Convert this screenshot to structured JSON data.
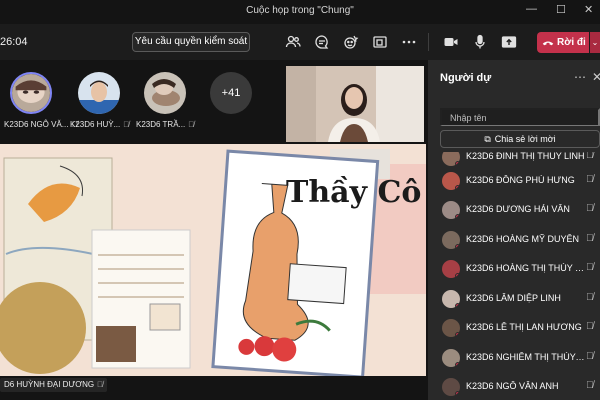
{
  "window": {
    "title": "Cuộc họp trong \"Chung\""
  },
  "toolbar": {
    "time": "26:04",
    "request_control_label": "Yêu cầu quyền kiểm soát",
    "leave_label": "Rời đi",
    "icons": [
      "people-icon",
      "chat-icon",
      "reactions-icon",
      "rooms-icon",
      "more-icon",
      "camera-icon",
      "mic-icon",
      "share-tray-icon",
      "phone-icon"
    ]
  },
  "stage": {
    "participants": [
      {
        "name": "K23D6 NGÔ VĂ...",
        "muted": true,
        "active": true
      },
      {
        "name": "K23D6 HUỲ...",
        "muted": true
      },
      {
        "name": "K23D6 TRẦ...",
        "muted": true
      }
    ],
    "overflow_count": "+41",
    "presenter": "D6 HUỲNH ĐẠI DƯƠNG"
  },
  "shared_content": {
    "card_heading": "Thầy Cô"
  },
  "panel": {
    "title": "Người dự",
    "search_placeholder": "Nhập tên",
    "share_invite_label": "Chia sẻ lời mời",
    "attendees": [
      "K23D6 ĐINH THỊ THÚY LINH",
      "K23D6 ĐỒNG PHÚ HƯNG",
      "K23D6 DƯƠNG HẢI VÂN",
      "K23D6 HOÀNG MỸ DUYÊN",
      "K23D6 HOÀNG THỊ THÚY HƯ...",
      "K23D6 LÂM DIỆP LINH",
      "K23D6 LÊ THỊ LAN HƯƠNG",
      "K23D6 NGHIÊM THỊ THÙY LI...",
      "K23D6 NGÔ VÂN ANH"
    ]
  },
  "colors": {
    "leave": "#c4314b",
    "accent": "#7f85f5",
    "panel_bg": "#292929"
  }
}
